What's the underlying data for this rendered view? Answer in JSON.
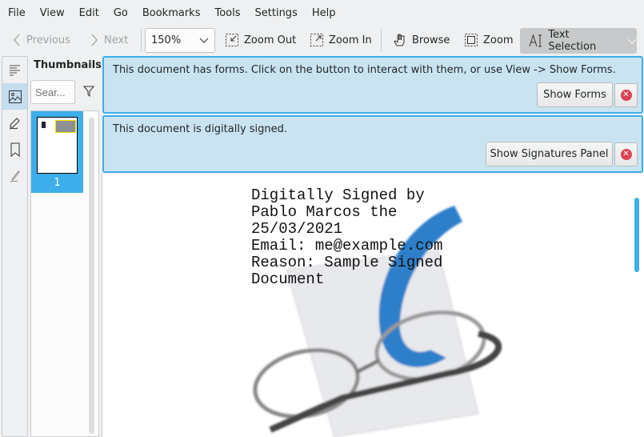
{
  "menu": [
    "File",
    "View",
    "Edit",
    "Go",
    "Bookmarks",
    "Tools",
    "Settings",
    "Help"
  ],
  "toolbar": {
    "previous": "Previous",
    "next": "Next",
    "zoom_value": "150%",
    "zoom_out": "Zoom Out",
    "zoom_in": "Zoom In",
    "browse": "Browse",
    "zoom": "Zoom",
    "text_selection": "Text Selection"
  },
  "sidebar": {
    "tabs": [
      {
        "icon": "table-of-contents-icon"
      },
      {
        "icon": "thumbnails-icon",
        "active": true
      },
      {
        "icon": "annotations-icon"
      },
      {
        "icon": "bookmark-icon"
      },
      {
        "icon": "signatures-icon"
      }
    ]
  },
  "thumbnails": {
    "title": "Thumbnails",
    "search_placeholder": "Sear...",
    "pages": [
      {
        "number": "1"
      }
    ]
  },
  "banners": {
    "forms": {
      "message": "This document has forms. Click on the button to interact with them, or use View -> Show Forms.",
      "button": "Show Forms"
    },
    "signed": {
      "message": "This document is digitally signed.",
      "button": "Show Signatures Panel"
    }
  },
  "document": {
    "signature_lines": [
      "Digitally Signed by",
      "Pablo Marcos the",
      "25/03/2021",
      "Email: me@example.com",
      "Reason: Sample Signed",
      "Document"
    ]
  },
  "colors": {
    "accent": "#3daee9",
    "banner_bg": "#c9e3f1",
    "close": "#da4453"
  }
}
